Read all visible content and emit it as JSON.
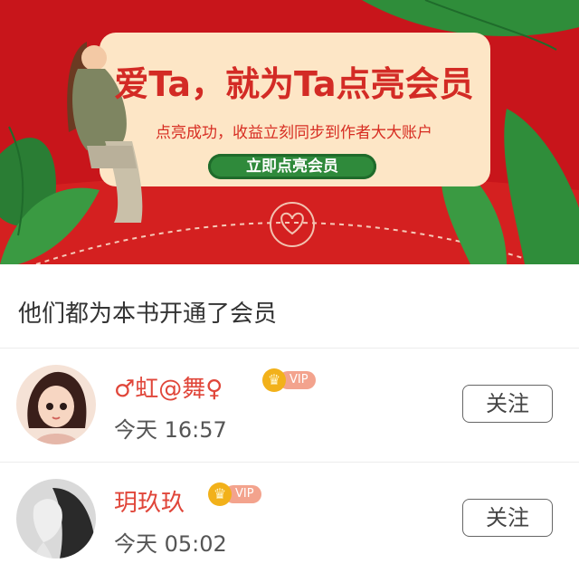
{
  "banner": {
    "headline": "爱Ta，就为Ta点亮会员",
    "subline": "点亮成功，收益立刻同步到作者大大账户",
    "cta_label": "立即点亮会员",
    "colors": {
      "background": "#c8151b",
      "card": "#fde6c6",
      "button": "#2f8a3b"
    }
  },
  "section": {
    "title": "他们都为本书开通了会员"
  },
  "members": [
    {
      "name": "♂虹@舞♀",
      "vip_label": "VIP",
      "time": "今天 16:57",
      "follow_label": "关注"
    },
    {
      "name": "玥玖玖",
      "vip_label": "VIP",
      "time": "今天 05:02",
      "follow_label": "关注"
    }
  ]
}
